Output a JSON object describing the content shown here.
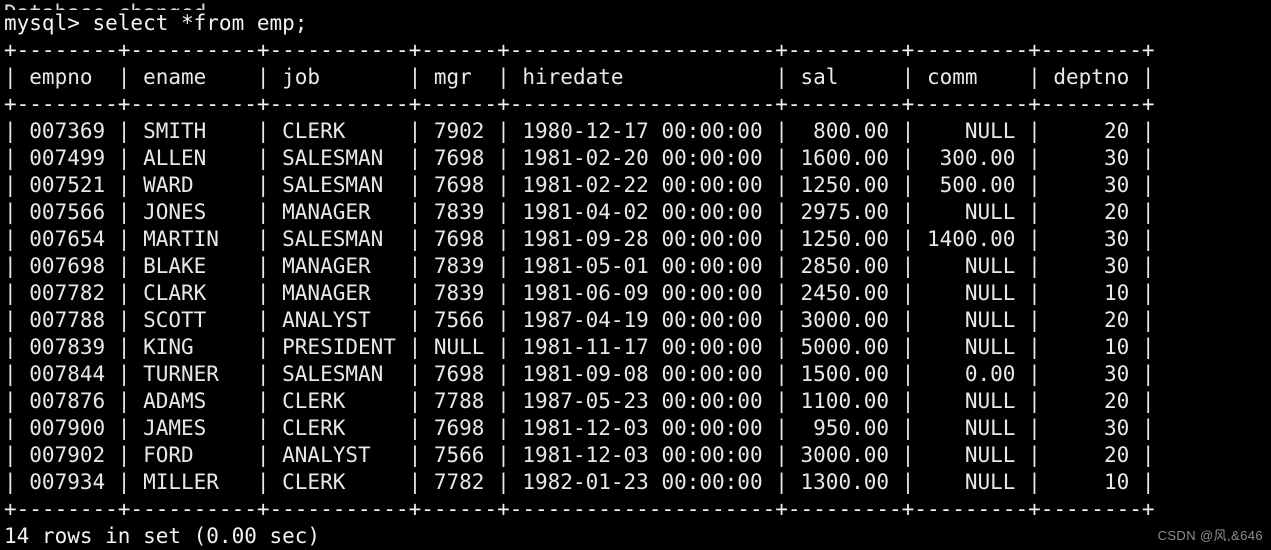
{
  "terminal": {
    "scrollback_partial_line": "Database changed",
    "prompt_line": "mysql> select *from emp;",
    "footer_status": "14 rows in set (0.00 sec)",
    "watermark": "CSDN @风,&646",
    "background_color": "#000000",
    "text_color": "#e8e8e8"
  },
  "table": {
    "separator": "+--------+--------+-----------+------+---------------------+---------+---------+--------+",
    "columns": [
      {
        "name": "empno",
        "width": 8,
        "align": "right"
      },
      {
        "name": "ename",
        "width": 10,
        "align": "left"
      },
      {
        "name": "job",
        "width": 11,
        "align": "left"
      },
      {
        "name": "mgr",
        "width": 6,
        "align": "right"
      },
      {
        "name": "hiredate",
        "width": 21,
        "align": "left"
      },
      {
        "name": "sal",
        "width": 9,
        "align": "right"
      },
      {
        "name": "comm",
        "width": 9,
        "align": "right"
      },
      {
        "name": "deptno",
        "width": 8,
        "align": "right"
      }
    ],
    "headers": [
      "empno",
      "ename",
      "job",
      "mgr",
      "hiredate",
      "sal",
      "comm",
      "deptno"
    ],
    "rows": [
      [
        "007369",
        "SMITH",
        "CLERK",
        "7902",
        "1980-12-17 00:00:00",
        "800.00",
        "NULL",
        "20"
      ],
      [
        "007499",
        "ALLEN",
        "SALESMAN",
        "7698",
        "1981-02-20 00:00:00",
        "1600.00",
        "300.00",
        "30"
      ],
      [
        "007521",
        "WARD",
        "SALESMAN",
        "7698",
        "1981-02-22 00:00:00",
        "1250.00",
        "500.00",
        "30"
      ],
      [
        "007566",
        "JONES",
        "MANAGER",
        "7839",
        "1981-04-02 00:00:00",
        "2975.00",
        "NULL",
        "20"
      ],
      [
        "007654",
        "MARTIN",
        "SALESMAN",
        "7698",
        "1981-09-28 00:00:00",
        "1250.00",
        "1400.00",
        "30"
      ],
      [
        "007698",
        "BLAKE",
        "MANAGER",
        "7839",
        "1981-05-01 00:00:00",
        "2850.00",
        "NULL",
        "30"
      ],
      [
        "007782",
        "CLARK",
        "MANAGER",
        "7839",
        "1981-06-09 00:00:00",
        "2450.00",
        "NULL",
        "10"
      ],
      [
        "007788",
        "SCOTT",
        "ANALYST",
        "7566",
        "1987-04-19 00:00:00",
        "3000.00",
        "NULL",
        "20"
      ],
      [
        "007839",
        "KING",
        "PRESIDENT",
        "NULL",
        "1981-11-17 00:00:00",
        "5000.00",
        "NULL",
        "10"
      ],
      [
        "007844",
        "TURNER",
        "SALESMAN",
        "7698",
        "1981-09-08 00:00:00",
        "1500.00",
        "0.00",
        "30"
      ],
      [
        "007876",
        "ADAMS",
        "CLERK",
        "7788",
        "1987-05-23 00:00:00",
        "1100.00",
        "NULL",
        "20"
      ],
      [
        "007900",
        "JAMES",
        "CLERK",
        "7698",
        "1981-12-03 00:00:00",
        "950.00",
        "NULL",
        "30"
      ],
      [
        "007902",
        "FORD",
        "ANALYST",
        "7566",
        "1981-12-03 00:00:00",
        "3000.00",
        "NULL",
        "20"
      ],
      [
        "007934",
        "MILLER",
        "CLERK",
        "7782",
        "1982-01-23 00:00:00",
        "1300.00",
        "NULL",
        "10"
      ]
    ]
  }
}
